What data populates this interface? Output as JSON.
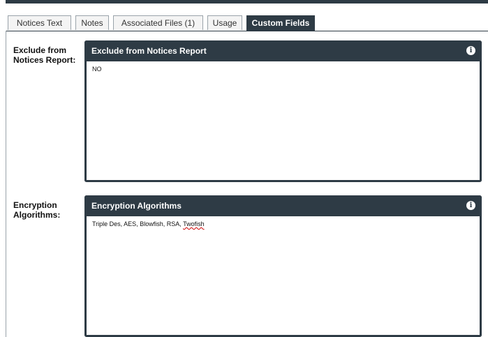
{
  "tabs": [
    {
      "label": "Notices Text"
    },
    {
      "label": "Notes"
    },
    {
      "label": "Associated Files (1)"
    },
    {
      "label": "Usage"
    },
    {
      "label": "Custom Fields",
      "active": true
    }
  ],
  "fields": [
    {
      "label": "Exclude from Notices Report:",
      "panel_title": "Exclude from Notices Report",
      "value": "NO"
    },
    {
      "label": "Encryption Algorithms:",
      "panel_title": "Encryption Algorithms",
      "value_prefix": "Triple Des, AES, Blowfish, RSA, ",
      "value_misspelled": "Twofish"
    }
  ],
  "icons": {
    "info": "info-icon"
  },
  "colors": {
    "header": "#2e3b45",
    "tab_border": "#9aa3aa",
    "spellcheck": "#cc0000"
  }
}
